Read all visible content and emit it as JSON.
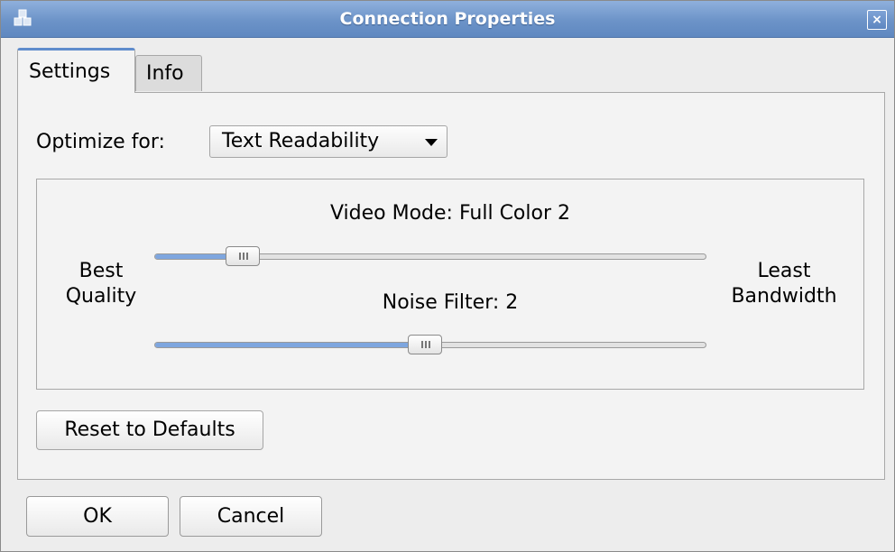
{
  "window": {
    "title": "Connection Properties",
    "app_icon": "connection-icon",
    "close_icon": "close-icon",
    "close_glyph": "×"
  },
  "tabs": [
    {
      "label": "Settings",
      "selected": true
    },
    {
      "label": "Info",
      "selected": false
    }
  ],
  "settings": {
    "optimize_label": "Optimize for:",
    "optimize_value": "Text Readability",
    "video_mode": {
      "label": "Video Mode: Full Color 2",
      "level": 0.16
    },
    "noise_filter": {
      "label": "Noise Filter: 2",
      "level": 0.49
    },
    "left_label_line1": "Best",
    "left_label_line2": "Quality",
    "right_label_line1": "Least",
    "right_label_line2": "Bandwidth",
    "reset_label": "Reset to Defaults"
  },
  "buttons": {
    "ok": "OK",
    "cancel": "Cancel"
  },
  "colors": {
    "titlebar": "#6c93c8",
    "slider_fill": "#7ea6df",
    "tab_accent": "#5f8ccc"
  }
}
